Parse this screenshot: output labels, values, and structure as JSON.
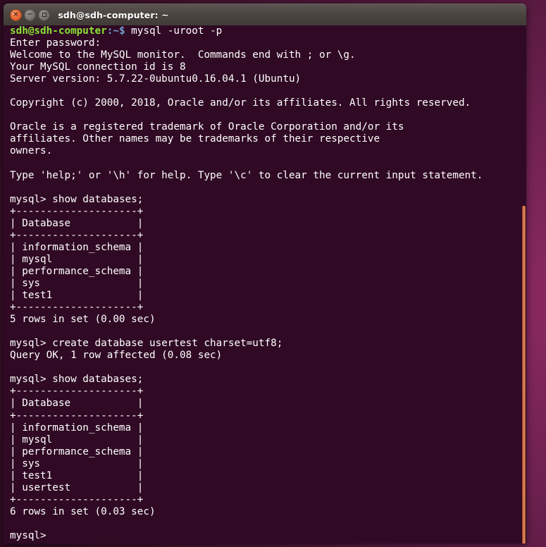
{
  "window": {
    "title": "sdh@sdh-computer: ~",
    "controls": {
      "close": "×",
      "minimize": "−",
      "maximize": "□"
    }
  },
  "colors": {
    "terminal_background": "#300a24",
    "prompt_user_host": "#8ae234",
    "prompt_path": "#729fcf",
    "foreground": "#ffffff",
    "titlebar": "#4b4541",
    "close_button": "#e9703c",
    "scrollbar_thumb": "#d4714a"
  },
  "terminal": {
    "shell_prompt": {
      "user_host": "sdh@sdh-computer",
      "path_sym": ":~$"
    },
    "mysql_prompt": "mysql>",
    "lines": [
      {
        "type": "shell-command",
        "user_host": "sdh@sdh-computer",
        "path_sym": ":~$",
        "command": " mysql -uroot -p"
      },
      {
        "type": "output",
        "text": "Enter password:"
      },
      {
        "type": "output",
        "text": "Welcome to the MySQL monitor.  Commands end with ; or \\g."
      },
      {
        "type": "output",
        "text": "Your MySQL connection id is 8"
      },
      {
        "type": "output",
        "text": "Server version: 5.7.22-0ubuntu0.16.04.1 (Ubuntu)"
      },
      {
        "type": "output",
        "text": ""
      },
      {
        "type": "output",
        "text": "Copyright (c) 2000, 2018, Oracle and/or its affiliates. All rights reserved."
      },
      {
        "type": "output",
        "text": ""
      },
      {
        "type": "output",
        "text": "Oracle is a registered trademark of Oracle Corporation and/or its"
      },
      {
        "type": "output",
        "text": "affiliates. Other names may be trademarks of their respective"
      },
      {
        "type": "output",
        "text": "owners."
      },
      {
        "type": "output",
        "text": ""
      },
      {
        "type": "output",
        "text": "Type 'help;' or '\\h' for help. Type '\\c' to clear the current input statement."
      },
      {
        "type": "output",
        "text": ""
      },
      {
        "type": "mysql-command",
        "prompt": "mysql>",
        "command": " show databases;"
      },
      {
        "type": "output",
        "text": "+--------------------+"
      },
      {
        "type": "output",
        "text": "| Database           |"
      },
      {
        "type": "output",
        "text": "+--------------------+"
      },
      {
        "type": "output",
        "text": "| information_schema |"
      },
      {
        "type": "output",
        "text": "| mysql              |"
      },
      {
        "type": "output",
        "text": "| performance_schema |"
      },
      {
        "type": "output",
        "text": "| sys                |"
      },
      {
        "type": "output",
        "text": "| test1              |"
      },
      {
        "type": "output",
        "text": "+--------------------+"
      },
      {
        "type": "output",
        "text": "5 rows in set (0.00 sec)"
      },
      {
        "type": "output",
        "text": ""
      },
      {
        "type": "mysql-command",
        "prompt": "mysql>",
        "command": " create database usertest charset=utf8;"
      },
      {
        "type": "output",
        "text": "Query OK, 1 row affected (0.08 sec)"
      },
      {
        "type": "output",
        "text": ""
      },
      {
        "type": "mysql-command",
        "prompt": "mysql>",
        "command": " show databases;"
      },
      {
        "type": "output",
        "text": "+--------------------+"
      },
      {
        "type": "output",
        "text": "| Database           |"
      },
      {
        "type": "output",
        "text": "+--------------------+"
      },
      {
        "type": "output",
        "text": "| information_schema |"
      },
      {
        "type": "output",
        "text": "| mysql              |"
      },
      {
        "type": "output",
        "text": "| performance_schema |"
      },
      {
        "type": "output",
        "text": "| sys                |"
      },
      {
        "type": "output",
        "text": "| test1              |"
      },
      {
        "type": "output",
        "text": "| usertest           |"
      },
      {
        "type": "output",
        "text": "+--------------------+"
      },
      {
        "type": "output",
        "text": "6 rows in set (0.03 sec)"
      },
      {
        "type": "output",
        "text": ""
      },
      {
        "type": "mysql-command",
        "prompt": "mysql>",
        "command": ""
      }
    ],
    "databases_before": [
      "information_schema",
      "mysql",
      "performance_schema",
      "sys",
      "test1"
    ],
    "databases_after": [
      "information_schema",
      "mysql",
      "performance_schema",
      "sys",
      "test1",
      "usertest"
    ],
    "result_before": "5 rows in set (0.00 sec)",
    "result_after": "6 rows in set (0.03 sec)",
    "create_result": "Query OK, 1 row affected (0.08 sec)"
  }
}
